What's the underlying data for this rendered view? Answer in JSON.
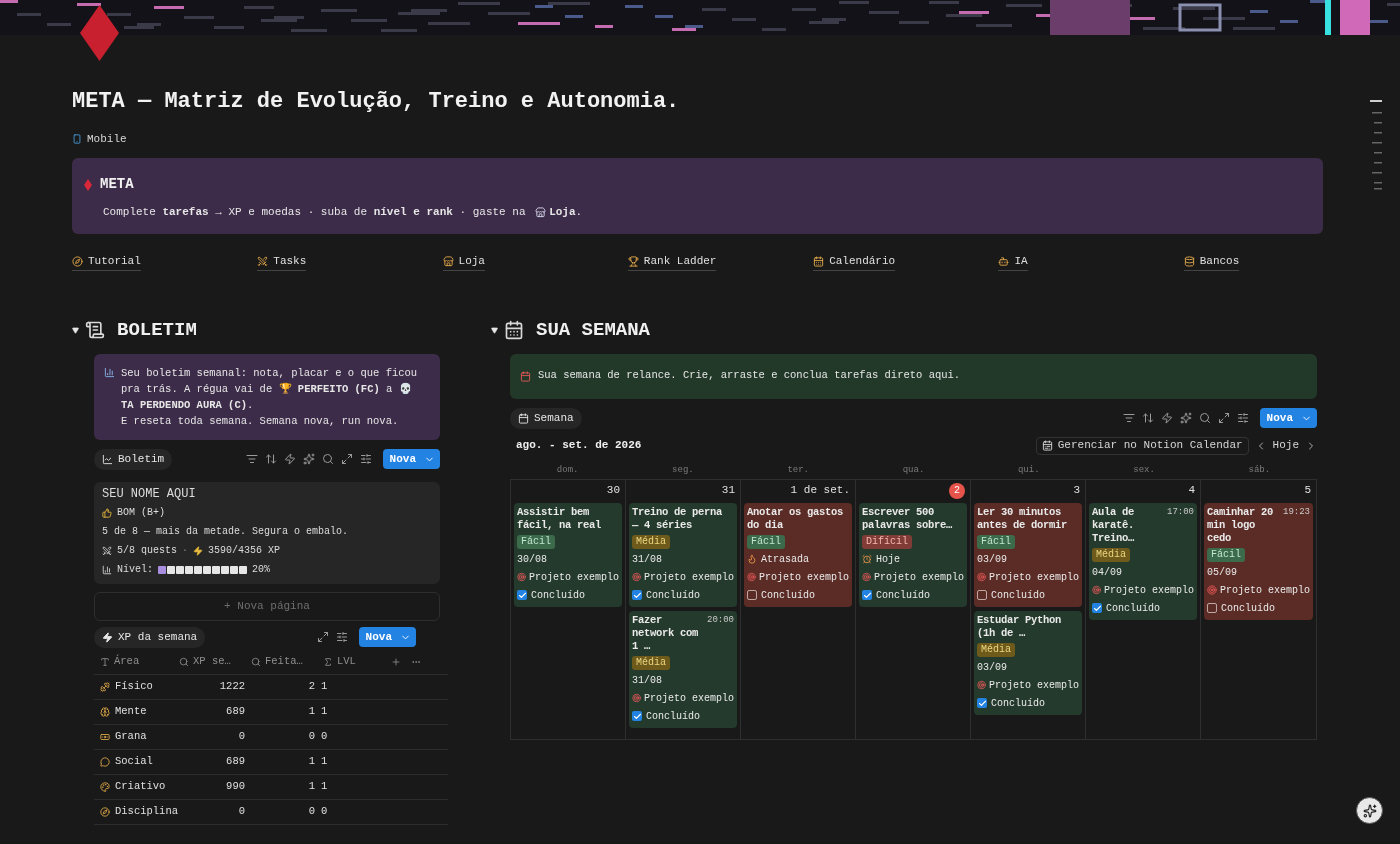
{
  "page": {
    "title": "META — Matriz de Evolução, Treino e Autonomia.",
    "links": [
      {
        "label": "Mobile"
      }
    ]
  },
  "callout": {
    "title": "META",
    "text": "Complete **tarefas** → XP e moedas · suba de **nível e rank** · gaste na",
    "link": "Loja",
    "end": "."
  },
  "nav": [
    {
      "label": "Tutorial"
    },
    {
      "label": "Tasks"
    },
    {
      "label": "Loja"
    },
    {
      "label": "Rank Ladder"
    },
    {
      "label": "Calendário"
    },
    {
      "label": "IA"
    },
    {
      "label": "Bancos"
    }
  ],
  "boletim": {
    "heading": "BOLETIM",
    "expanded": true,
    "callout": "Seu boletim semanal: nota, placar e o que ficou pra trás. A régua vai de 🏆 **PERFEITO (FC)** a 💀 **TA PERDENDO AURA (C)**.\nE reseta toda semana. Semana nova, run nova.",
    "view": "Boletim",
    "new_button": "Nova",
    "card": {
      "name": "SEU NOME AQUI",
      "grade": "BOM (B+)",
      "message": "5 de 8 — mais da metade. Segura o embalo.",
      "quests": "5/8 quests",
      "separator": "·",
      "xp": "3590/4356 XP",
      "level_label": "Nível:",
      "level": 0.1,
      "reading": "20%"
    },
    "new_page": "+ Nova página"
  },
  "xp_table": {
    "view": "XP da semana",
    "new_button": "Nova",
    "columns": [
      "Área",
      "XP se…",
      "Feita…",
      "LVL"
    ],
    "rows": [
      {
        "area": "Físico",
        "xp": "1222",
        "done": "2",
        "lvl": "1"
      },
      {
        "area": "Mente",
        "xp": "689",
        "done": "1",
        "lvl": "1"
      },
      {
        "area": "Grana",
        "xp": "0",
        "done": "0",
        "lvl": "0"
      },
      {
        "area": "Social",
        "xp": "689",
        "done": "1",
        "lvl": "1"
      },
      {
        "area": "Criativo",
        "xp": "990",
        "done": "1",
        "lvl": "1"
      },
      {
        "area": "Disciplina",
        "xp": "0",
        "done": "0",
        "lvl": "0"
      }
    ]
  },
  "semana": {
    "heading": "SUA SEMANA",
    "expanded": true,
    "callout": "Sua semana de relance. Crie, arraste e conclua tarefas direto aqui.",
    "view": "Semana",
    "new_button": "Nova",
    "month": "ago. - set. de 2026",
    "manage": "Gerenciar no Notion Calendar",
    "today_button": "Hoje",
    "weekdays": [
      "dom.",
      "seg.",
      "ter.",
      "qua.",
      "qui.",
      "sex.",
      "sáb."
    ],
    "days": [
      {
        "label": "30",
        "today": false,
        "events": [
          {
            "title": "Assistir bem fácil, na real",
            "difficulty": {
              "label": "Fácil",
              "kind": "easy"
            },
            "meta": {
              "kind": "date",
              "text": "30/08"
            },
            "project": "Projeto exemplo",
            "done_label": "Concluído",
            "checked": true
          }
        ]
      },
      {
        "label": "31",
        "today": false,
        "events": [
          {
            "title": "Treino de perna — 4 séries",
            "difficulty": {
              "label": "Média",
              "kind": "medium"
            },
            "meta": {
              "kind": "date",
              "text": "31/08"
            },
            "project": "Projeto exemplo",
            "done_label": "Concluído",
            "checked": true
          },
          {
            "title": "Fazer network com 1 …",
            "time": "20:00",
            "difficulty": {
              "label": "Média",
              "kind": "medium"
            },
            "meta": {
              "kind": "date",
              "text": "31/08"
            },
            "project": "Projeto exemplo",
            "done_label": "Concluído",
            "checked": true
          }
        ]
      },
      {
        "label": "1 de set.",
        "today": false,
        "events": [
          {
            "title": "Anotar os gastos do dia",
            "difficulty": {
              "label": "Fácil",
              "kind": "easy"
            },
            "meta": {
              "kind": "overdue",
              "text": "Atrasada"
            },
            "project": "Projeto exemplo",
            "done_label": "Concluído",
            "checked": false
          }
        ]
      },
      {
        "label": "2",
        "today": true,
        "events": [
          {
            "title": "Escrever 500 palavras sobre…",
            "difficulty": {
              "label": "Difícil",
              "kind": "hard"
            },
            "meta": {
              "kind": "today",
              "text": "Hoje"
            },
            "project": "Projeto exemplo",
            "done_label": "Concluído",
            "checked": true
          }
        ]
      },
      {
        "label": "3",
        "today": false,
        "events": [
          {
            "title": "Ler 30 minutos antes de dormir",
            "difficulty": {
              "label": "Fácil",
              "kind": "easy"
            },
            "meta": {
              "kind": "date",
              "text": "03/09"
            },
            "project": "Projeto exemplo",
            "done_label": "Concluído",
            "checked": false
          },
          {
            "title": "Estudar Python (1h de …",
            "difficulty": {
              "label": "Média",
              "kind": "medium"
            },
            "meta": {
              "kind": "date",
              "text": "03/09"
            },
            "project": "Projeto exemplo",
            "done_label": "Concluído",
            "checked": true
          }
        ]
      },
      {
        "label": "4",
        "today": false,
        "events": [
          {
            "title": "Aula de karatê. Treino…",
            "time": "17:00",
            "difficulty": {
              "label": "Média",
              "kind": "medium"
            },
            "meta": {
              "kind": "date",
              "text": "04/09"
            },
            "project": "Projeto exemplo",
            "done_label": "Concluído",
            "checked": true
          }
        ]
      },
      {
        "label": "5",
        "today": false,
        "events": [
          {
            "title": "Caminhar 20 min logo cedo",
            "time": "19:23",
            "difficulty": {
              "label": "Fácil",
              "kind": "easy"
            },
            "meta": {
              "kind": "date",
              "text": "05/09"
            },
            "project": "Projeto exemplo",
            "done_label": "Concluído",
            "checked": false
          }
        ]
      }
    ]
  }
}
